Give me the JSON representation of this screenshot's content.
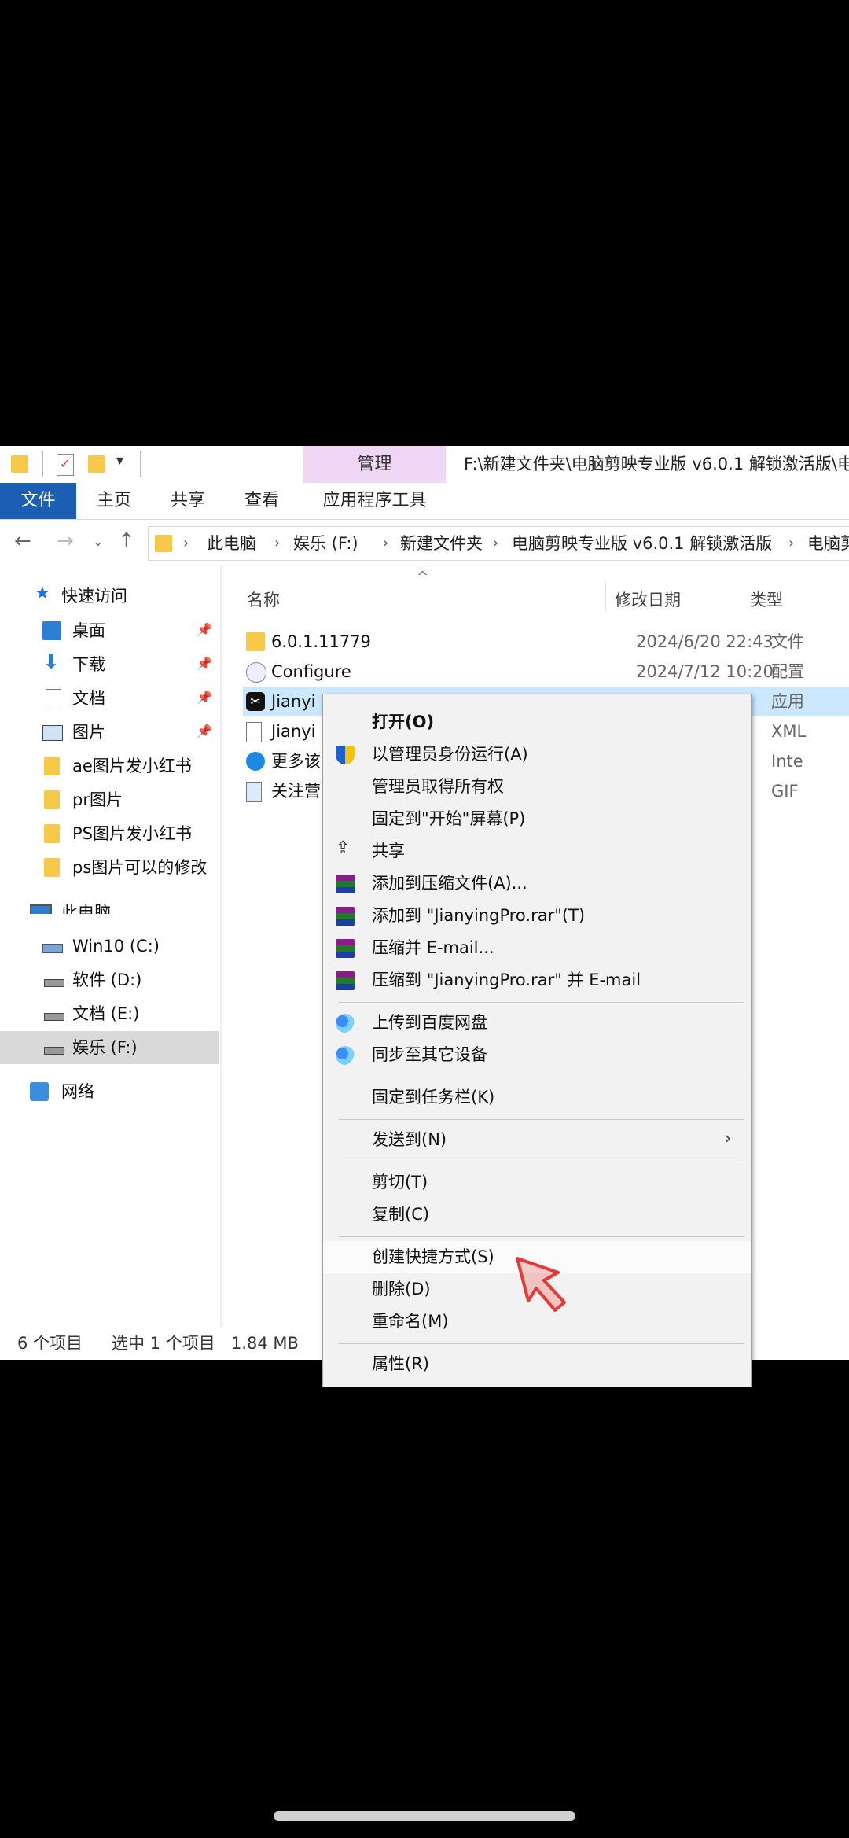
{
  "window": {
    "title": "F:\\新建文件夹\\电脑剪映专业版 v6.0.1 解锁激活版\\电",
    "manage_label": "管理",
    "ribbon_tabs": [
      "文件",
      "主页",
      "共享",
      "查看",
      "应用程序工具"
    ]
  },
  "address": {
    "crumbs": [
      "此电脑",
      "娱乐 (F:)",
      "新建文件夹",
      "电脑剪映专业版 v6.0.1 解锁激活版",
      "电脑剪"
    ]
  },
  "sidebar": {
    "quick_access": "快速访问",
    "items": [
      {
        "label": "桌面",
        "pinned": true
      },
      {
        "label": "下载",
        "pinned": true
      },
      {
        "label": "文档",
        "pinned": true
      },
      {
        "label": "图片",
        "pinned": true
      },
      {
        "label": "ae图片发小红书"
      },
      {
        "label": "pr图片"
      },
      {
        "label": "PS图片发小红书"
      },
      {
        "label": "ps图片可以的修改"
      }
    ],
    "this_pc": "此电脑",
    "drives": [
      "Win10 (C:)",
      "软件 (D:)",
      "文档 (E:)",
      "娱乐 (F:)"
    ],
    "network": "网络"
  },
  "columns": {
    "name": "名称",
    "date": "修改日期",
    "type": "类型"
  },
  "files": [
    {
      "name": "6.0.1.11779",
      "date": "2024/6/20 22:43",
      "type": "文件"
    },
    {
      "name": "Configure",
      "date": "2024/7/12 10:20",
      "type": "配置"
    },
    {
      "name": "Jianyi",
      "date": "",
      "type": "应用"
    },
    {
      "name": "Jianyi",
      "date": "",
      "type": "XML"
    },
    {
      "name": "更多该",
      "date": "",
      "type": "Inte"
    },
    {
      "name": "关注营",
      "date": "",
      "type": "GIF"
    }
  ],
  "status": {
    "count": "6 个项目",
    "selected": "选中 1 个项目",
    "size": "1.84 MB"
  },
  "context_menu": {
    "open": "打开(O)",
    "run_admin": "以管理员身份运行(A)",
    "take_owner": "管理员取得所有权",
    "pin_start": "固定到\"开始\"屏幕(P)",
    "share": "共享",
    "add_archive": "添加到压缩文件(A)...",
    "add_rar": "添加到 \"JianyingPro.rar\"(T)",
    "compress_email": "压缩并 E-mail...",
    "compress_rar_email": "压缩到 \"JianyingPro.rar\" 并 E-mail",
    "upload_baidu": "上传到百度网盘",
    "sync_devices": "同步至其它设备",
    "pin_taskbar": "固定到任务栏(K)",
    "send_to": "发送到(N)",
    "cut": "剪切(T)",
    "copy": "复制(C)",
    "create_shortcut": "创建快捷方式(S)",
    "delete": "删除(D)",
    "rename": "重命名(M)",
    "properties": "属性(R)"
  },
  "colors": {
    "file_tab": "#1a5fb4",
    "manage_tab": "#f0d6f5",
    "selected_row": "#cce8ff",
    "arrow": "#e53935"
  }
}
